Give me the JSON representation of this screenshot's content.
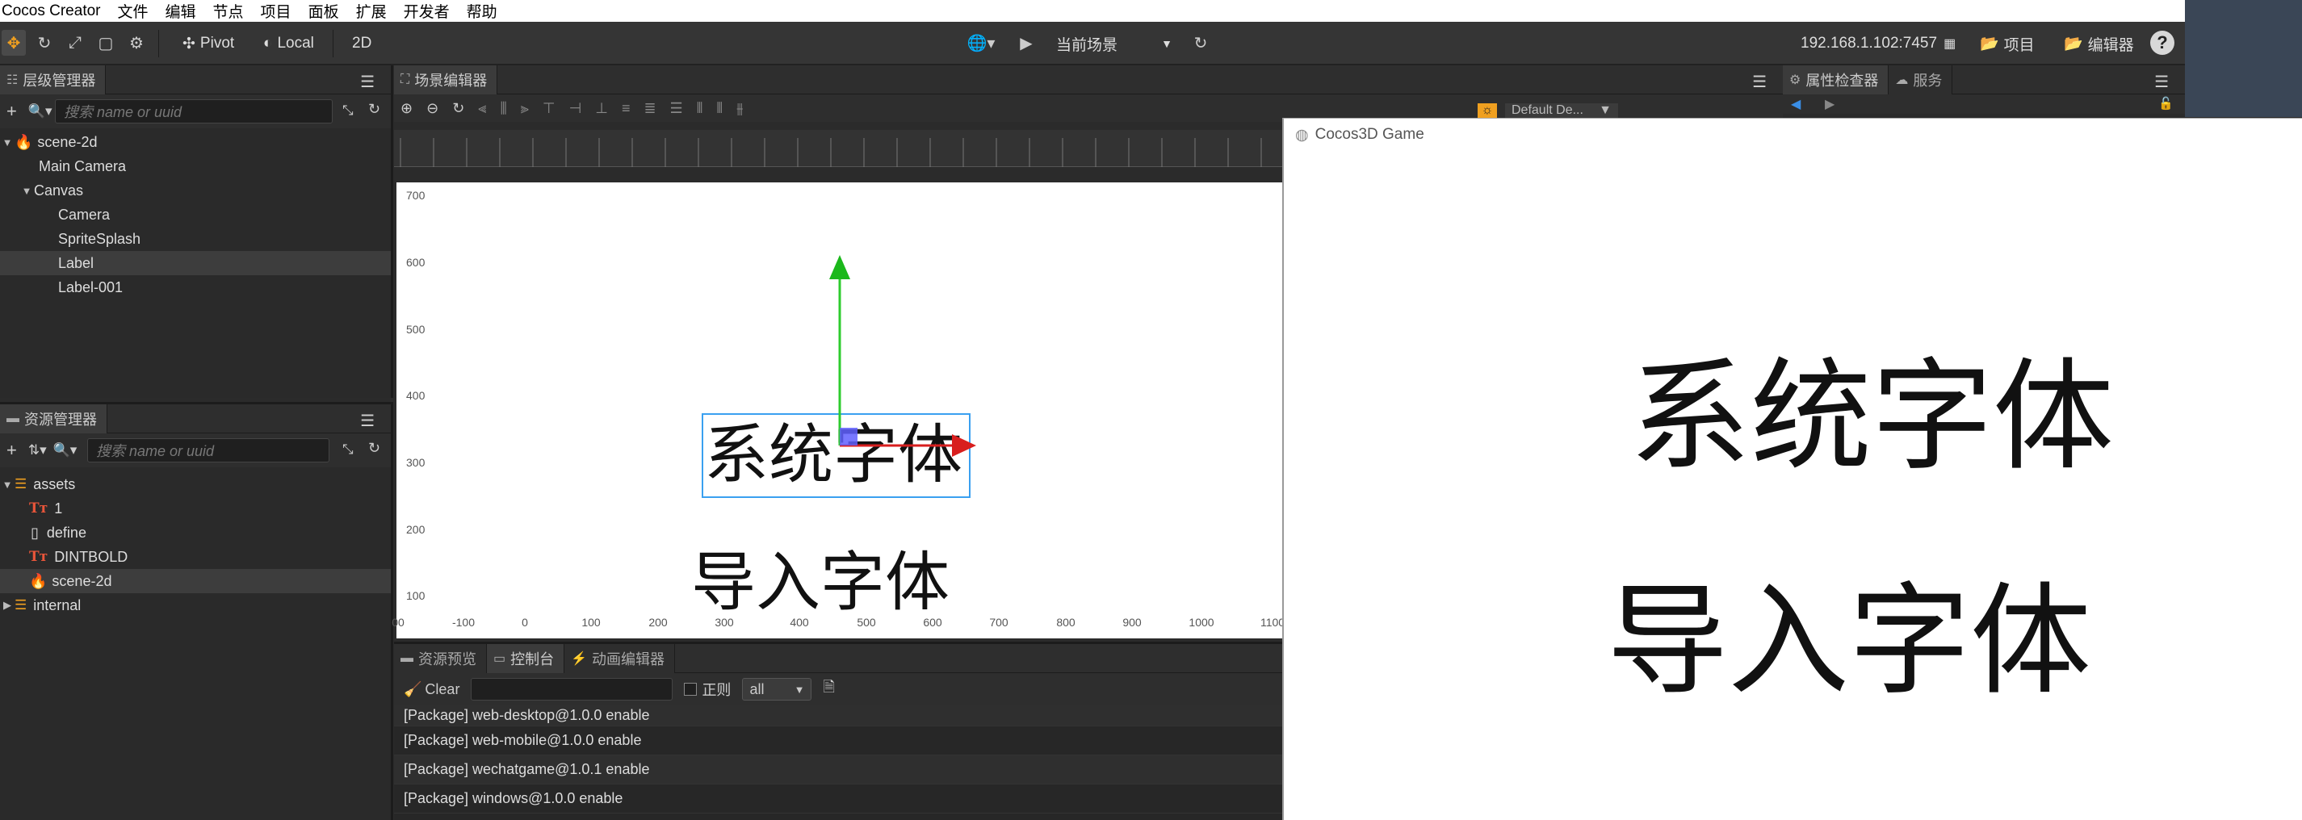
{
  "menubar": {
    "app": "Cocos Creator",
    "items": [
      "文件",
      "编辑",
      "节点",
      "项目",
      "面板",
      "扩展",
      "开发者",
      "帮助"
    ]
  },
  "toolbar": {
    "pivot": "Pivot",
    "local": "Local",
    "mode2d": "2D",
    "scene_select": "当前场景",
    "ip": "192.168.1.102:7457",
    "project_btn": "项目",
    "editor_btn": "编辑器",
    "help": "?"
  },
  "hierarchy": {
    "title": "层级管理器",
    "search_placeholder": "搜索 name or uuid",
    "nodes": [
      "scene-2d",
      "Main Camera",
      "Canvas",
      "Camera",
      "SpriteSplash",
      "Label",
      "Label-001"
    ]
  },
  "assets": {
    "title": "资源管理器",
    "search_placeholder": "搜索 name or uuid",
    "items": [
      "assets",
      "1",
      "define",
      "DINTBOLD",
      "scene-2d",
      "internal"
    ]
  },
  "scene": {
    "title": "场景编辑器",
    "default_design": "Default De...",
    "y_ticks": [
      "700",
      "600",
      "500",
      "400",
      "300",
      "200",
      "100"
    ],
    "x_ticks": [
      "00",
      "-100",
      "0",
      "100",
      "200",
      "300",
      "400",
      "500",
      "600",
      "700",
      "800",
      "900",
      "1000",
      "1100"
    ],
    "label1": "系统字体",
    "label2": "导入字体"
  },
  "console": {
    "tabs": [
      "资源预览",
      "控制台",
      "动画编辑器"
    ],
    "clear": "Clear",
    "regex": "正则",
    "filter": "all",
    "logs": [
      "[Package] web-desktop@1.0.0 enable",
      "[Package] web-mobile@1.0.0 enable",
      "[Package] wechatgame@1.0.1 enable",
      "[Package] windows@1.0.0 enable"
    ]
  },
  "inspector": {
    "tab1": "属性检查器",
    "tab2": "服务"
  },
  "game": {
    "title": "Cocos3D Game",
    "text1": "系统字体",
    "text2": "导入字体"
  },
  "colors": {
    "accent": "#f0a020",
    "selection_box": "#3aa0f0",
    "gizmo_y": "#2ecc2e",
    "gizmo_x": "#d81e1e"
  }
}
